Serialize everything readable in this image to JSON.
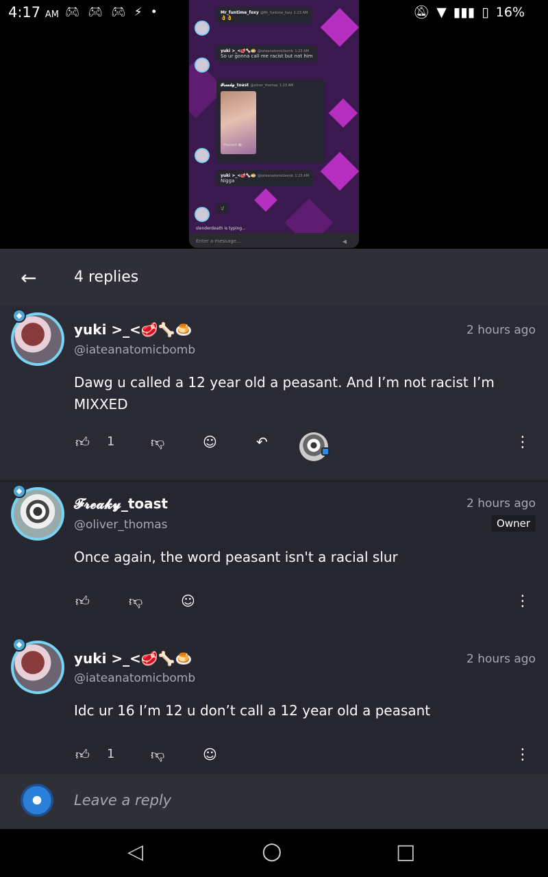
{
  "status_bar": {
    "time": "4:17",
    "ampm": "AM",
    "battery": "16%",
    "left_icons": [
      "gamepad-icon",
      "gamepad-icon",
      "gamepad-icon",
      "bolt-icon",
      "dot-icon"
    ],
    "right_icons": [
      "notifications-off-icon",
      "wifi-icon",
      "lte-signal-icon",
      "battery-icon"
    ]
  },
  "preview": {
    "messages": [
      {
        "name": "Mr_funtime_foxy",
        "handle": "@Mr_funtime_foxy",
        "time": "1:23 AM",
        "text": "👌👌"
      },
      {
        "name": "yuki >_<🥩🦴🍮",
        "handle": "@iateanatomicbomb",
        "time": "1:23 AM",
        "text": "So ur gonna call me racist but not him"
      },
      {
        "name": "𝓕𝓻𝓮𝓪𝓴𝔂_toast",
        "handle": "@oliver_thomas",
        "time": "1:23 AM",
        "text": "Peasant 😂"
      },
      {
        "name": "yuki >_<🥩🦴🍮",
        "handle": "@iateanatomicbomb",
        "time": "1:23 AM",
        "text": "Nigga"
      },
      {
        "name": "",
        "handle": "",
        "time": "",
        "text": ":/"
      }
    ],
    "typing": "slenderdeath is typing...",
    "input_placeholder": "Enter a message..."
  },
  "header": {
    "title": "4 replies"
  },
  "replies": [
    {
      "name": "yuki >_<🥩🦴🍮",
      "handle": "@iateanatomicbomb",
      "time": "2 hours ago",
      "text": "Dawg u called a 12 year old a peasant. And I’m not racist I’m MIXXED",
      "likes": "1"
    },
    {
      "name": "𝓕𝓻𝓮𝓪𝓴𝔂_toast",
      "handle": "@oliver_thomas",
      "time": "2 hours ago",
      "badge": "Owner",
      "text": "Once again, the word peasant isn't a racial slur"
    },
    {
      "name": "yuki >_<🥩🦴🍮",
      "handle": "@iateanatomicbomb",
      "time": "2 hours ago",
      "text": "Idc ur 16 I’m 12 u don’t call a 12 year old a peasant",
      "likes": "1"
    }
  ],
  "reply_bar": {
    "placeholder": "Leave a reply"
  },
  "colors": {
    "background": "#262630",
    "header": "#2f2f38",
    "avatar_ring": "#79d3f3",
    "accent_blue": "#2f8be5"
  }
}
